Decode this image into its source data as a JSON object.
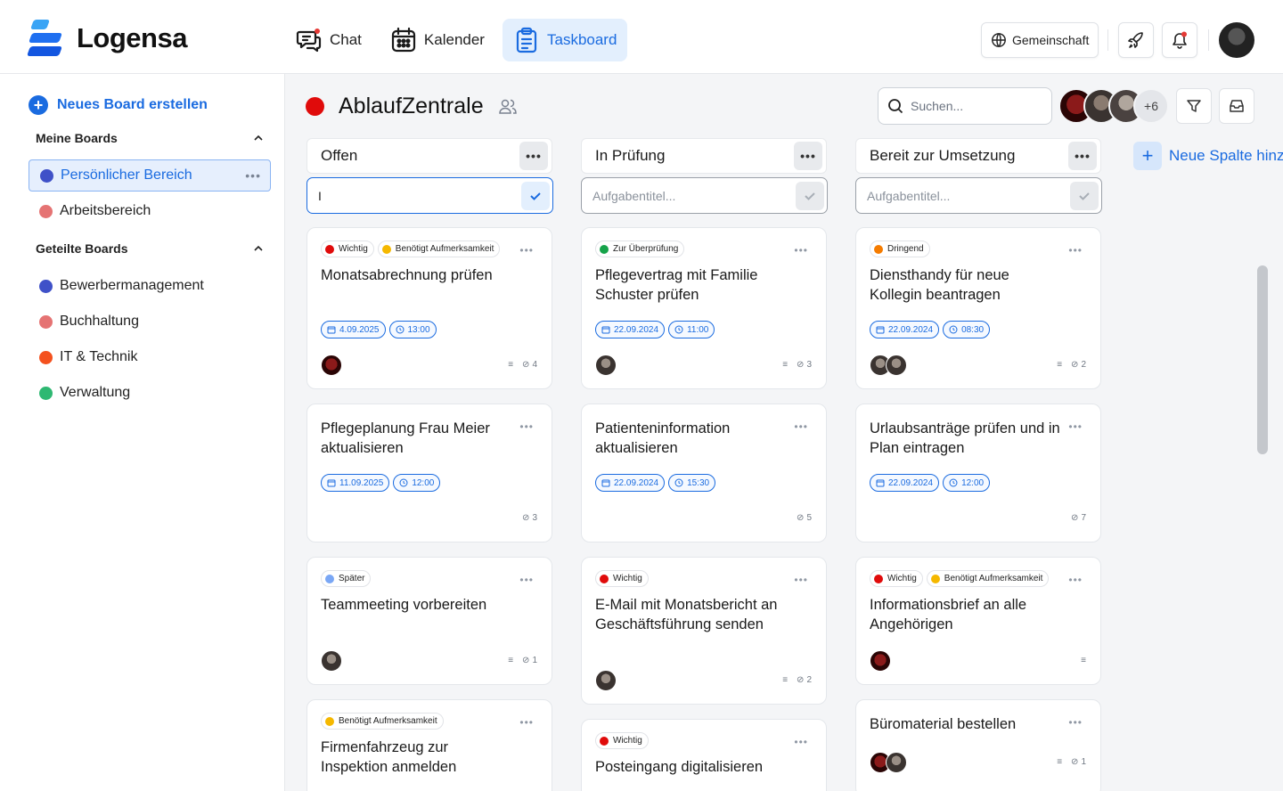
{
  "app": {
    "name": "Logensa"
  },
  "nav": [
    {
      "label": "Chat",
      "icon": "chat-icon",
      "active": false
    },
    {
      "label": "Kalender",
      "icon": "calendar-icon",
      "active": false
    },
    {
      "label": "Taskboard",
      "icon": "clipboard-icon",
      "active": true
    }
  ],
  "topbar": {
    "community_label": "Gemeinschaft"
  },
  "sidebar": {
    "new_board_label": "Neues Board erstellen",
    "my_boards_label": "Meine Boards",
    "shared_boards_label": "Geteilte Boards",
    "my_boards": [
      {
        "label": "Persönlicher Bereich",
        "color": "#3f51c8",
        "active": true
      },
      {
        "label": "Arbeitsbereich",
        "color": "#e57373",
        "active": false
      }
    ],
    "shared_boards": [
      {
        "label": "Bewerbermanagement",
        "color": "#3f51c8"
      },
      {
        "label": "Buchhaltung",
        "color": "#e57373"
      },
      {
        "label": "IT & Technik",
        "color": "#f4511e"
      },
      {
        "label": "Verwaltung",
        "color": "#2eb872"
      }
    ]
  },
  "board": {
    "name": "AblaufZentrale",
    "color": "#e00b0b",
    "search_placeholder": "Suchen...",
    "members_extra": "+6"
  },
  "columns": [
    {
      "title": "Offen",
      "input_value": "I",
      "input_placeholder": "Aufgabentitel..."
    },
    {
      "title": "In Prüfung",
      "input_value": "",
      "input_placeholder": "Aufgabentitel..."
    },
    {
      "title": "Bereit zur Umsetzung",
      "input_value": "",
      "input_placeholder": "Aufgabentitel..."
    }
  ],
  "add_column_label": "Neue Spalte hinzufügen",
  "colors": {
    "accent": "#1a6be0",
    "tag_wichtig": "#e00b0b",
    "tag_aufmerksamkeit": "#f5b800",
    "tag_pruefung": "#16a34a",
    "tag_dringend": "#f57c00",
    "tag_spaeter": "#7aa7f5"
  },
  "cards": {
    "c0_0": {
      "tags": [
        "Wichtig",
        "Benötigt Aufmerksamkeit"
      ],
      "title": "Monatsabrechnung prüfen",
      "date": "4.09.2025",
      "time": "13:00",
      "attachments": "4"
    },
    "c0_1": {
      "title": "Pflegeplanung Frau Meier aktualisieren",
      "date": "11.09.2025",
      "time": "12:00",
      "attachments": "3"
    },
    "c0_2": {
      "tags": [
        "Später"
      ],
      "title": "Teammeeting vorbereiten",
      "attachments": "1"
    },
    "c0_3": {
      "tags": [
        "Benötigt Aufmerksamkeit"
      ],
      "title": "Firmenfahrzeug zur Inspektion anmelden"
    },
    "c1_0": {
      "tags": [
        "Zur Überprüfung"
      ],
      "title": "Pflegevertrag mit Familie Schuster prüfen",
      "date": "22.09.2024",
      "time": "11:00",
      "attachments": "3"
    },
    "c1_1": {
      "title": "Patienteninformation aktualisieren",
      "date": "22.09.2024",
      "time": "15:30",
      "attachments": "5"
    },
    "c1_2": {
      "tags": [
        "Wichtig"
      ],
      "title": "E-Mail mit Monatsbericht an Geschäftsführung senden",
      "attachments": "2"
    },
    "c1_3": {
      "tags": [
        "Wichtig"
      ],
      "title": "Posteingang digitalisieren"
    },
    "c2_0": {
      "tags": [
        "Dringend"
      ],
      "title": "Diensthandy für neue Kollegin beantragen",
      "date": "22.09.2024",
      "time": "08:30",
      "attachments": "2"
    },
    "c2_1": {
      "title": "Urlaubsanträge prüfen und in Plan eintragen",
      "date": "22.09.2024",
      "time": "12:00",
      "attachments": "7"
    },
    "c2_2": {
      "tags": [
        "Wichtig",
        "Benötigt Aufmerksamkeit"
      ],
      "title": "Informationsbrief an alle Angehörigen"
    },
    "c2_3": {
      "title": "Büromaterial bestellen",
      "attachments": "1"
    }
  }
}
